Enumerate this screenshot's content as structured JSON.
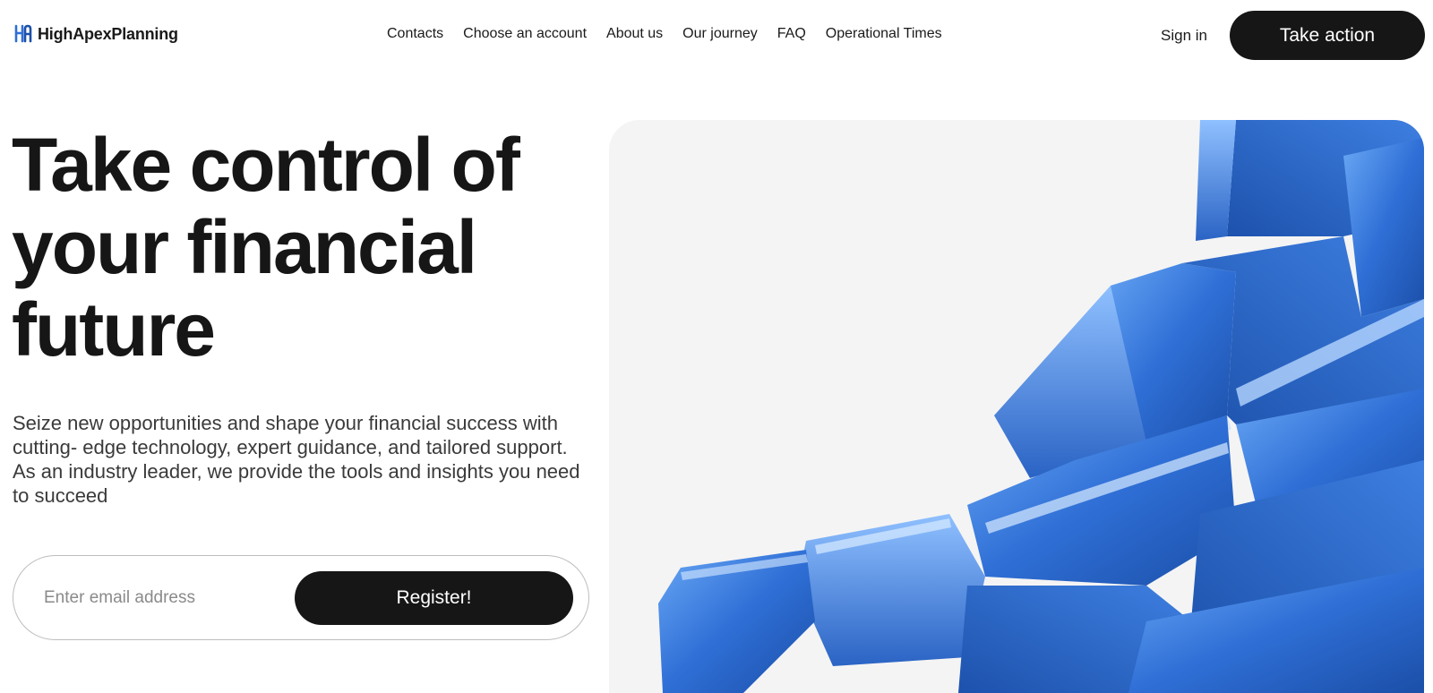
{
  "brand": {
    "name": "HighApexPlanning",
    "logo_icon": "hap-monogram-icon",
    "accent_color": "#2f6fd6"
  },
  "nav": {
    "items": [
      {
        "label": "Contacts"
      },
      {
        "label": "Choose an account"
      },
      {
        "label": "About us"
      },
      {
        "label": "Our journey"
      },
      {
        "label": "FAQ"
      },
      {
        "label": "Operational Times"
      }
    ]
  },
  "header": {
    "sign_in_label": "Sign in",
    "cta_label": "Take action"
  },
  "hero": {
    "title": "Take control of your financial future",
    "description": "Seize new opportunities and shape your financial success with cutting- edge technology, expert guidance, and tailored support. As an industry leader, we provide the tools and insights you need to succeed",
    "email_placeholder": "Enter email address",
    "email_value": "",
    "register_label": "Register!",
    "image_icon": "abstract-blue-blocks-illustration"
  },
  "colors": {
    "dark_button": "#161616",
    "panel_bg": "#f4f4f4",
    "blue_primary": "#2f6fd6",
    "blue_light": "#6aa8f5",
    "blue_dark": "#1b4fa8"
  }
}
